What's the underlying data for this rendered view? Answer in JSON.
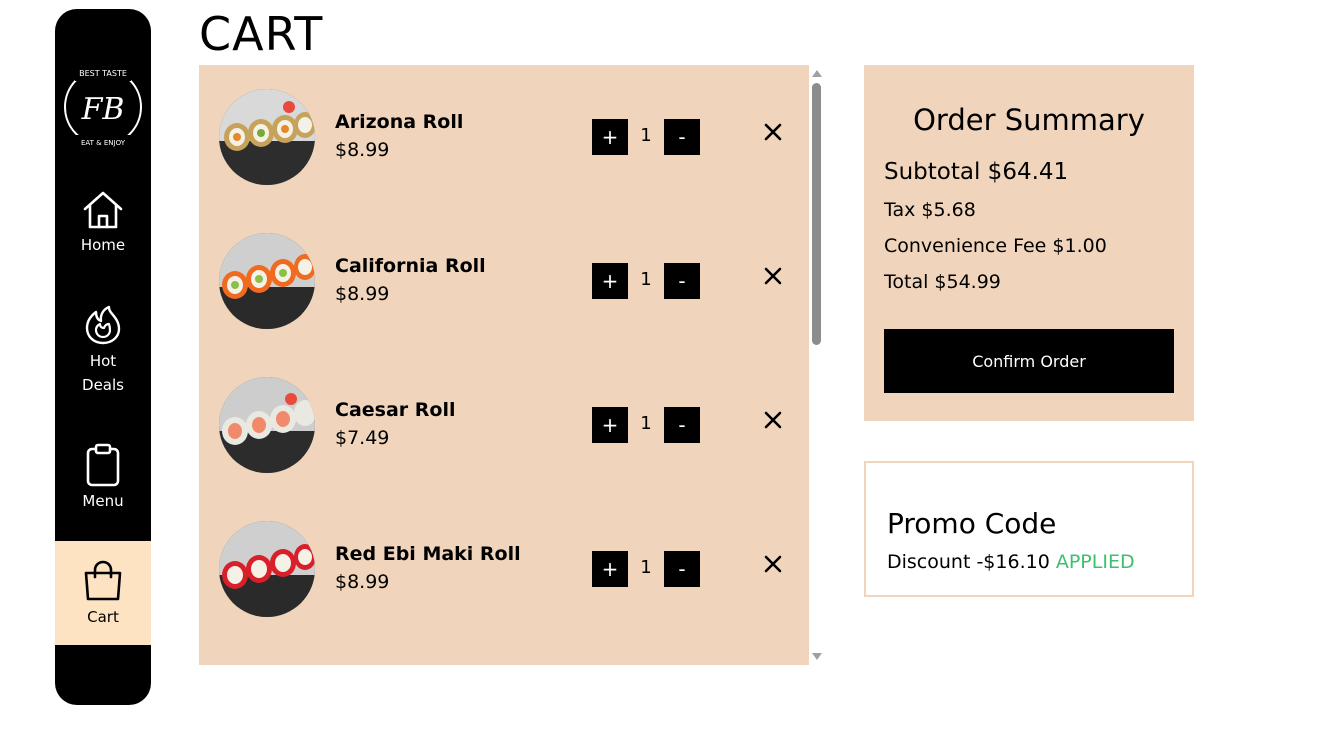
{
  "sidebar": {
    "logo": {
      "top_text": "BEST TASTE",
      "monogram": "FB",
      "bottom_text": "EAT & ENJOY"
    },
    "items": [
      {
        "label": "Home",
        "icon": "home-icon"
      },
      {
        "label": "Hot Deals",
        "icon": "flame-icon"
      },
      {
        "label": "Menu",
        "icon": "clipboard-icon"
      },
      {
        "label": "Cart",
        "icon": "shopping-bag-icon",
        "active": true
      }
    ]
  },
  "page": {
    "title": "CART"
  },
  "cart": {
    "items": [
      {
        "name": "Arizona Roll",
        "price": "$8.99",
        "qty": "1",
        "plus": "+",
        "minus": "-"
      },
      {
        "name": "California Roll",
        "price": "$8.99",
        "qty": "1",
        "plus": "+",
        "minus": "-"
      },
      {
        "name": "Caesar Roll",
        "price": "$7.49",
        "qty": "1",
        "plus": "+",
        "minus": "-"
      },
      {
        "name": "Red Ebi Maki Roll",
        "price": "$8.99",
        "qty": "1",
        "plus": "+",
        "minus": "-"
      }
    ]
  },
  "summary": {
    "title": "Order Summary",
    "subtotal": "Subtotal $64.41",
    "tax": "Tax $5.68",
    "fee": "Convenience Fee $1.00",
    "total": "Total $54.99",
    "confirm_label": "Confirm Order"
  },
  "promo": {
    "title": "Promo Code",
    "discount": "Discount -$16.10",
    "status": "APPLIED"
  },
  "colors": {
    "panel": "#f0d5bc",
    "active_nav": "#fde3c2",
    "applied": "#3dbf6e",
    "sidebar": "#000000"
  }
}
